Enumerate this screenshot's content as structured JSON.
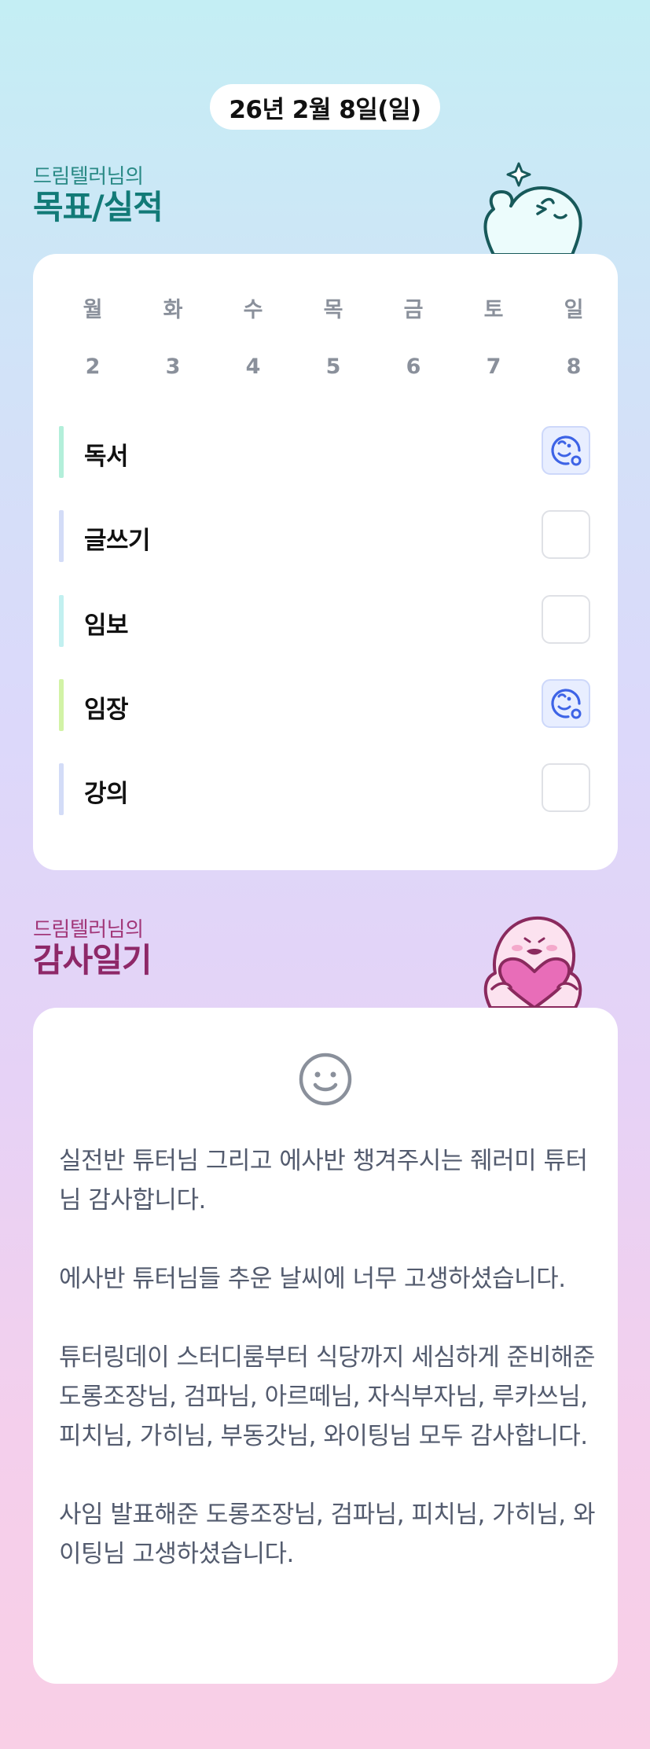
{
  "date": "26년 2월 8일(일)",
  "goals_section": {
    "subtitle": "드림텔러님의",
    "title": "목표/실적"
  },
  "week": {
    "days": [
      "월",
      "화",
      "수",
      "목",
      "금",
      "토",
      "일"
    ],
    "dates": [
      "2",
      "3",
      "4",
      "5",
      "6",
      "7",
      "8"
    ]
  },
  "goals": [
    {
      "name": "독서",
      "checked": true,
      "color": "#b3efda"
    },
    {
      "name": "글쓰기",
      "checked": false,
      "color": "#d3dcf7"
    },
    {
      "name": "임보",
      "checked": false,
      "color": "#c2f0f0"
    },
    {
      "name": "임장",
      "checked": true,
      "color": "#d2f3a6"
    },
    {
      "name": "강의",
      "checked": false,
      "color": "#d3dcf7"
    }
  ],
  "thanks_section": {
    "subtitle": "드림텔러님의",
    "title": "감사일기"
  },
  "diary": [
    "실전반 튜터님 그리고 에사반 챙겨주시는 줴러미 튜터님 감사합니다.",
    "에사반 튜터님들 추운 날씨에 너무 고생하셨습니다.",
    "튜터링데이 스터디룸부터 식당까지 세심하게 준비해준 도롱조장님, 검파님, 아르떼님, 자식부자님, 루카쓰님, 피치님, 가히님, 부동갓님, 와이팅님 모두 감사합니다.",
    "사임 발표해준 도롱조장님, 검파님, 피치님, 가히님, 와이팅님 고생하셨습니다."
  ],
  "colors": {
    "accent_blue": "#3d63e6",
    "goals_title": "#127a77",
    "thanks_title": "#8e2868",
    "heart": "#e86db8"
  },
  "icons": {
    "checked": "smiley-check-icon",
    "diary_mood": "smiley-face-icon"
  }
}
